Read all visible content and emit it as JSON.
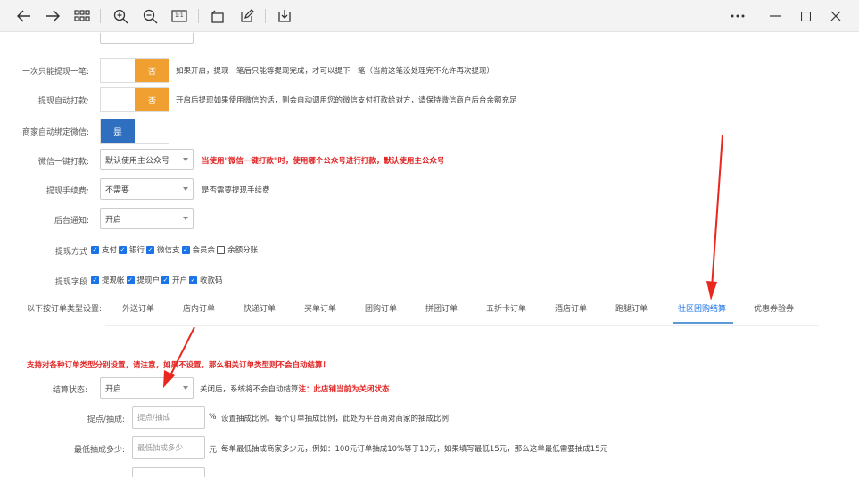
{
  "toolbar": {
    "icons": [
      "back-arrow-icon",
      "forward-arrow-icon",
      "grid-icon",
      "zoom-in-icon",
      "zoom-out-icon",
      "actual-size-icon",
      "rotate-icon",
      "edit-icon",
      "save-icon",
      "more-icon",
      "minimize-icon",
      "maximize-icon",
      "close-icon"
    ],
    "actual_size_label": "1:1"
  },
  "form": {
    "one_at_a_time": {
      "label": "一次只能提现一笔:",
      "toggle": "否",
      "hint": "如果开启，提现一笔后只能等提现完成，才可以提下一笔（当前这笔没处理完不允许再次提现）"
    },
    "auto_pay": {
      "label": "提现自动打款:",
      "toggle": "否",
      "hint": "开启后提现如果使用微信的话，则会自动调用您的微信支付打款给对方，请保持微信商户后台余额充足"
    },
    "auto_bind_wechat": {
      "label": "商家自动绑定微信:",
      "toggle": "是"
    },
    "wechat_one_click": {
      "label": "微信一键打款:",
      "value": "默认使用主公众号",
      "hint": "当使用\"微信一键打款\"时，使用哪个公众号进行打款，默认使用主公众号"
    },
    "fee": {
      "label": "提现手续费:",
      "value": "不需要",
      "hint": "是否需要提现手续费"
    },
    "notice": {
      "label": "后台通知:",
      "value": "开启"
    },
    "methods": {
      "label": "提现方式",
      "options": [
        "支付",
        "银行",
        "微信支",
        "会员余",
        "余额分账"
      ]
    },
    "fields": {
      "label": "提现字段",
      "options": [
        "提现帐",
        "提现户",
        "开户",
        "收款码"
      ]
    }
  },
  "tabs": {
    "label": "以下按订单类型设置:",
    "items": [
      "外送订单",
      "店内订单",
      "快递订单",
      "买单订单",
      "团购订单",
      "拼团订单",
      "五折卡订单",
      "酒店订单",
      "跑腿订单",
      "社区团购结算",
      "优惠券验券"
    ],
    "active_index": 9
  },
  "settle": {
    "warning": "支持对各种订单类型分别设置，请注意，如果不设置，那么相关订单类型则不会自动结算！",
    "status": {
      "label": "结算状态:",
      "value": "开启",
      "hint": "关闭后，系统将不会自动结算",
      "hint_red": "注：此店铺当前为关闭状态"
    },
    "commission": {
      "label": "提点/抽成:",
      "placeholder": "提点/抽成",
      "unit": "%",
      "hint": "设置抽成比例。每个订单抽成比例，此处为平台商对商家的抽成比例"
    },
    "min_commission": {
      "label": "最低抽成多少:",
      "placeholder": "最低抽成多少",
      "unit": "元",
      "hint": "每单最低抽成商家多少元，例如：100元订单抽成10%等于10元，如果填写最低15元，那么这单最低需要抽成15元"
    }
  },
  "colors": {
    "accent_orange": "#f0a030",
    "accent_blue": "#2f6fbf",
    "red": "#e02424"
  }
}
